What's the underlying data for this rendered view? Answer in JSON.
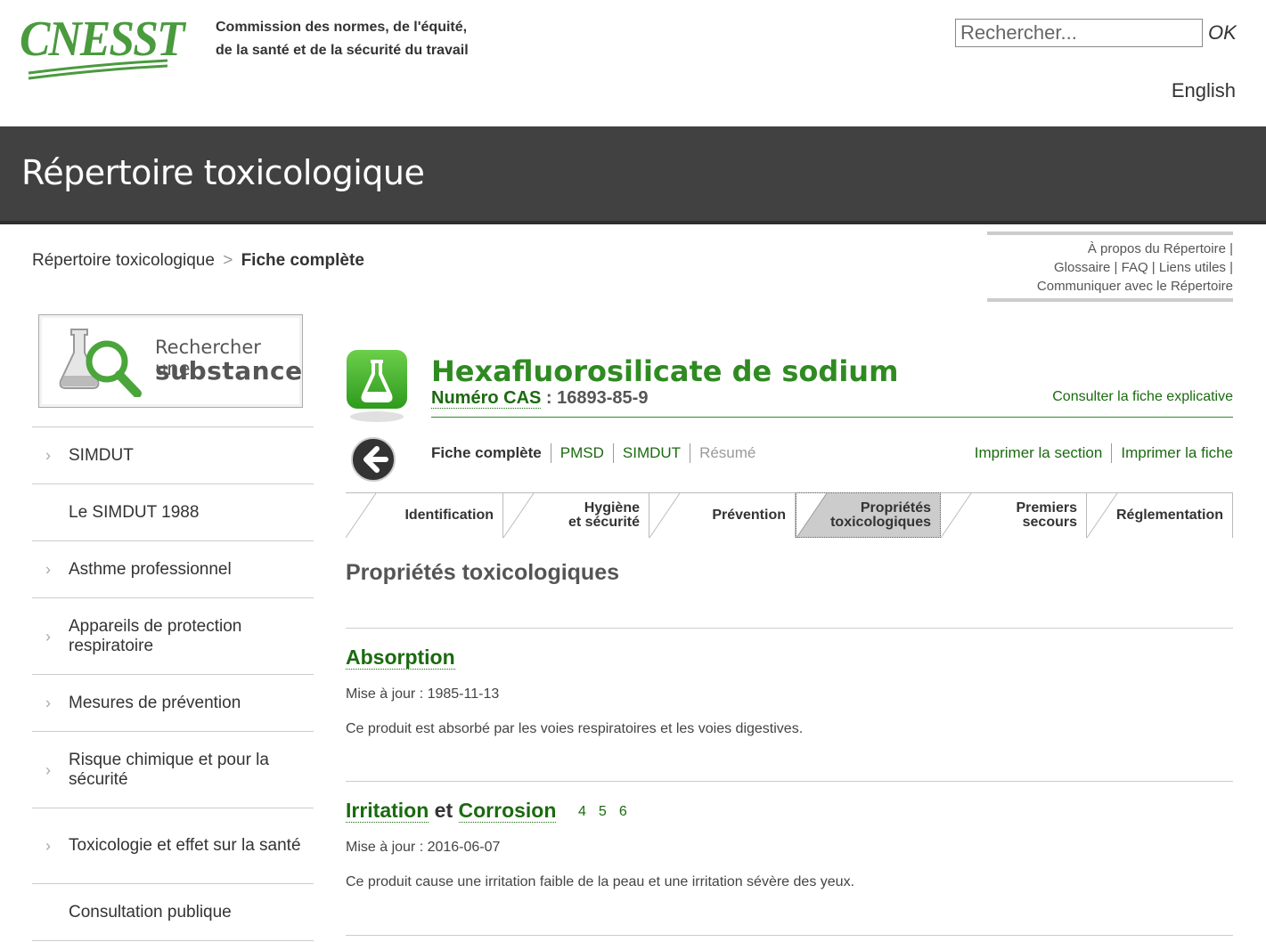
{
  "header": {
    "logo_text": "CNESST",
    "org_line1": "Commission des normes, de l'équité,",
    "org_line2": "de la santé et de la sécurité du travail",
    "search_placeholder": "Rechercher...",
    "search_ok": "OK",
    "language_link": "English"
  },
  "banner": {
    "title": "Répertoire toxicologique"
  },
  "breadcrumb": {
    "root": "Répertoire toxicologique",
    "separator": ">",
    "current": "Fiche complète"
  },
  "utility_links": {
    "about": "À propos du Répertoire",
    "glossary": "Glossaire",
    "faq": "FAQ",
    "useful_links": "Liens utiles",
    "contact": "Communiquer avec le Répertoire",
    "divider": "|"
  },
  "sidebar": {
    "search_substance": {
      "line1": "Rechercher une",
      "line2": "substance",
      "icon": "flask-magnifier-icon"
    },
    "items": [
      {
        "label": "SIMDUT",
        "has_chevron": true
      },
      {
        "label": "Le SIMDUT 1988",
        "has_chevron": false
      },
      {
        "label": "Asthme professionnel",
        "has_chevron": true
      },
      {
        "label": "Appareils de protection respiratoire",
        "has_chevron": true
      },
      {
        "label": "Mesures de prévention",
        "has_chevron": true
      },
      {
        "label": "Risque chimique et pour la sécurité",
        "has_chevron": true
      },
      {
        "label": "Toxicologie et effet sur la santé",
        "has_chevron": true
      },
      {
        "label": "Consultation publique",
        "has_chevron": false
      }
    ]
  },
  "substance": {
    "name": "Hexafluorosilicate de sodium",
    "cas_label": "Numéro CAS",
    "cas_sep": " : ",
    "cas_number": "16893-85-9",
    "explanatory_link": "Consulter la fiche explicative"
  },
  "subnav": {
    "items": [
      {
        "label": "Fiche complète",
        "state": "current"
      },
      {
        "label": "PMSD",
        "state": "link"
      },
      {
        "label": "SIMDUT",
        "state": "link"
      },
      {
        "label": "Résumé",
        "state": "disabled"
      }
    ],
    "print_section": "Imprimer la section",
    "print_sheet": "Imprimer la fiche"
  },
  "tabs": [
    {
      "line1": "Identification",
      "line2": "",
      "active": false
    },
    {
      "line1": "Hygiène",
      "line2": "et sécurité",
      "active": false
    },
    {
      "line1": "Prévention",
      "line2": "",
      "active": false
    },
    {
      "line1": "Propriétés",
      "line2": "toxicologiques",
      "active": true
    },
    {
      "line1": "Premiers",
      "line2": "secours",
      "active": false
    },
    {
      "line1": "Réglementation",
      "line2": "",
      "active": false
    }
  ],
  "content": {
    "section_title": "Propriétés toxicologiques",
    "sections": [
      {
        "heading": "Absorption",
        "updated": "Mise à jour : 1985-11-13",
        "text": "Ce produit est absorbé par les voies respiratoires et les voies digestives."
      },
      {
        "heading_term1": "Irritation",
        "heading_conj": "et",
        "heading_term2": "Corrosion",
        "refs": [
          "4",
          "5",
          "6"
        ],
        "updated": "Mise à jour : 2016-06-07",
        "text": "Ce produit cause une irritation faible de la peau et une irritation sévère des yeux."
      }
    ]
  },
  "colors": {
    "brand_green": "#4a9a3e",
    "link_green": "#1b6a10",
    "banner": "#414141"
  }
}
